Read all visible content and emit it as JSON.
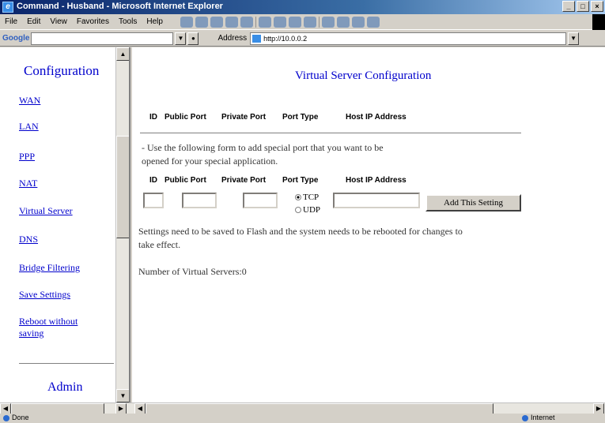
{
  "window": {
    "title": "Command - Husband - Microsoft Internet Explorer",
    "controls": [
      "_",
      "□",
      "×"
    ]
  },
  "menu": [
    "File",
    "Edit",
    "View",
    "Favorites",
    "Tools",
    "Help"
  ],
  "google_bar": {
    "logo": "Google"
  },
  "address_bar": {
    "label": "Address",
    "url": "http://10.0.0.2"
  },
  "sidebar": {
    "title": "Configuration",
    "links": [
      "WAN",
      "LAN",
      "PPP",
      "NAT",
      "Virtual Server",
      "DNS",
      "Bridge Filtering",
      "Save Settings",
      "Reboot without saving"
    ],
    "admin": "Admin"
  },
  "main": {
    "title": "Virtual Server Configuration",
    "table_headers": [
      "ID",
      "Public Port",
      "Private Port",
      "Port Type",
      "Host IP Address"
    ],
    "intro_text_line1": "- Use the following form to add special port that you want to be",
    "intro_text_line2": "opened for your special application.",
    "form_headers": [
      "ID",
      "Public Port",
      "Private Port",
      "Port Type",
      "Host IP Address"
    ],
    "form": {
      "id": "",
      "public_port": "",
      "private_port": "",
      "host_ip": "",
      "port_type_options": [
        "TCP",
        "UDP"
      ],
      "port_type_selected": "TCP"
    },
    "add_button": "Add This Setting",
    "note_line1": "Settings need to be saved to Flash and the system needs to be rebooted for changes to",
    "note_line2": "take effect.",
    "count_text": "Number of Virtual Servers:0"
  },
  "status": {
    "left": "Done",
    "right": "Internet"
  },
  "colors": {
    "link": "#0000cc",
    "chrome": "#d4d0c8"
  }
}
